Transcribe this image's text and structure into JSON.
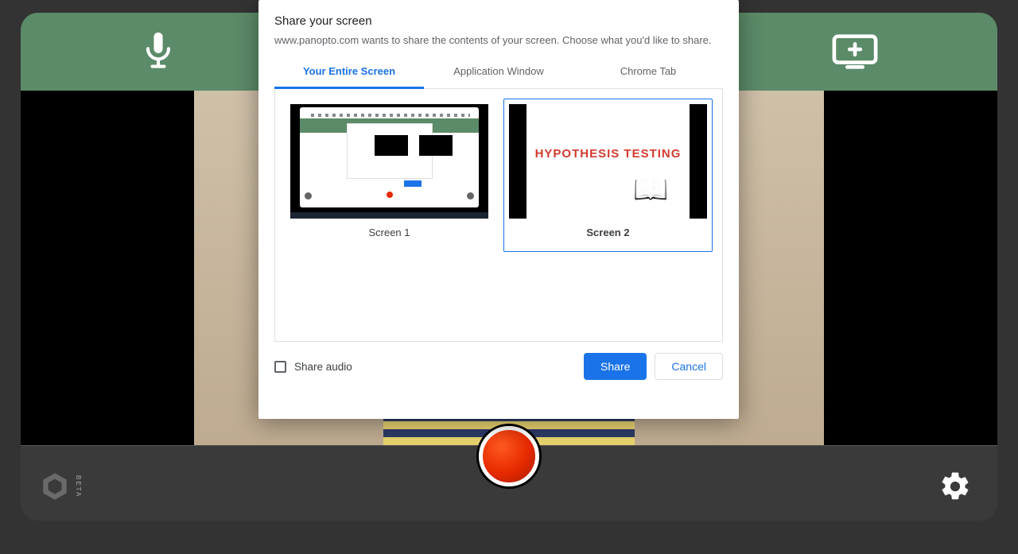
{
  "dialog": {
    "title": "Share your screen",
    "description": "www.panopto.com wants to share the contents of your screen. Choose what you'd like to share.",
    "tabs": {
      "entire": "Your Entire Screen",
      "window": "Application Window",
      "chrometab": "Chrome Tab"
    },
    "screens": {
      "s1_label": "Screen 1",
      "s2_label": "Screen 2",
      "s2_slide_title": "HYPOTHESIS TESTING"
    },
    "share_audio_label": "Share audio",
    "share_btn": "Share",
    "cancel_btn": "Cancel"
  },
  "app": {
    "beta_tag": "BETA"
  }
}
